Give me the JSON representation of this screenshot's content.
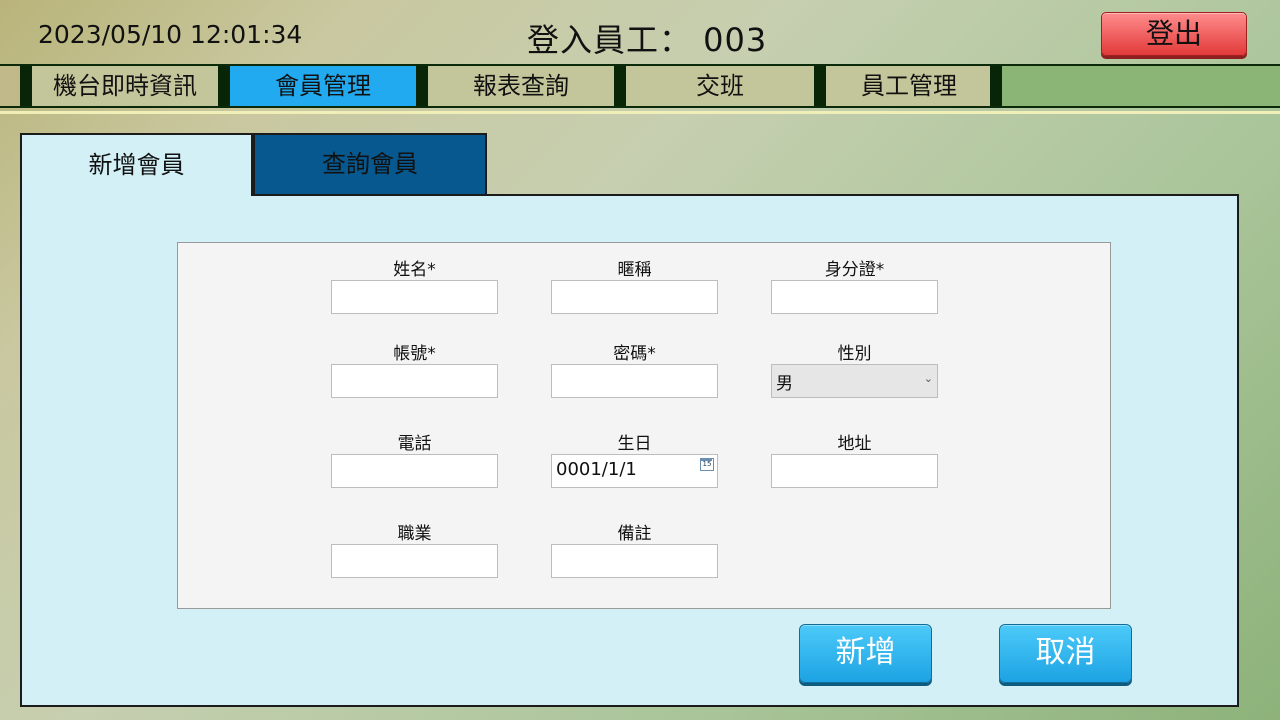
{
  "header": {
    "datetime": "2023/05/10 12:01:34",
    "employee": "登入員工： 003",
    "logout_label": "登出"
  },
  "nav": {
    "items": [
      "機台即時資訊",
      "會員管理",
      "報表查詢",
      "交班",
      "員工管理"
    ],
    "active": "會員管理"
  },
  "tabs": {
    "add_member": "新增會員",
    "query_member": "查詢會員"
  },
  "form": {
    "name_label": "姓名*",
    "nickname_label": "暱稱",
    "id_label": "身分證*",
    "account_label": "帳號*",
    "password_label": "密碼*",
    "gender_label": "性別",
    "gender_value": "男",
    "phone_label": "電話",
    "birthday_label": "生日",
    "birthday_value": "0001/1/1",
    "calendar_day": "15",
    "address_label": "地址",
    "job_label": "職業",
    "note_label": "備註"
  },
  "actions": {
    "add_label": "新增",
    "cancel_label": "取消"
  },
  "colors": {
    "active_nav": "#22aaf0",
    "logout": "#e23a3a",
    "panel": "#d2f0f6",
    "query_tab": "#06588f",
    "action_button": "#1da3e3"
  },
  "icons": [
    "chevron-down-icon",
    "calendar-icon"
  ]
}
